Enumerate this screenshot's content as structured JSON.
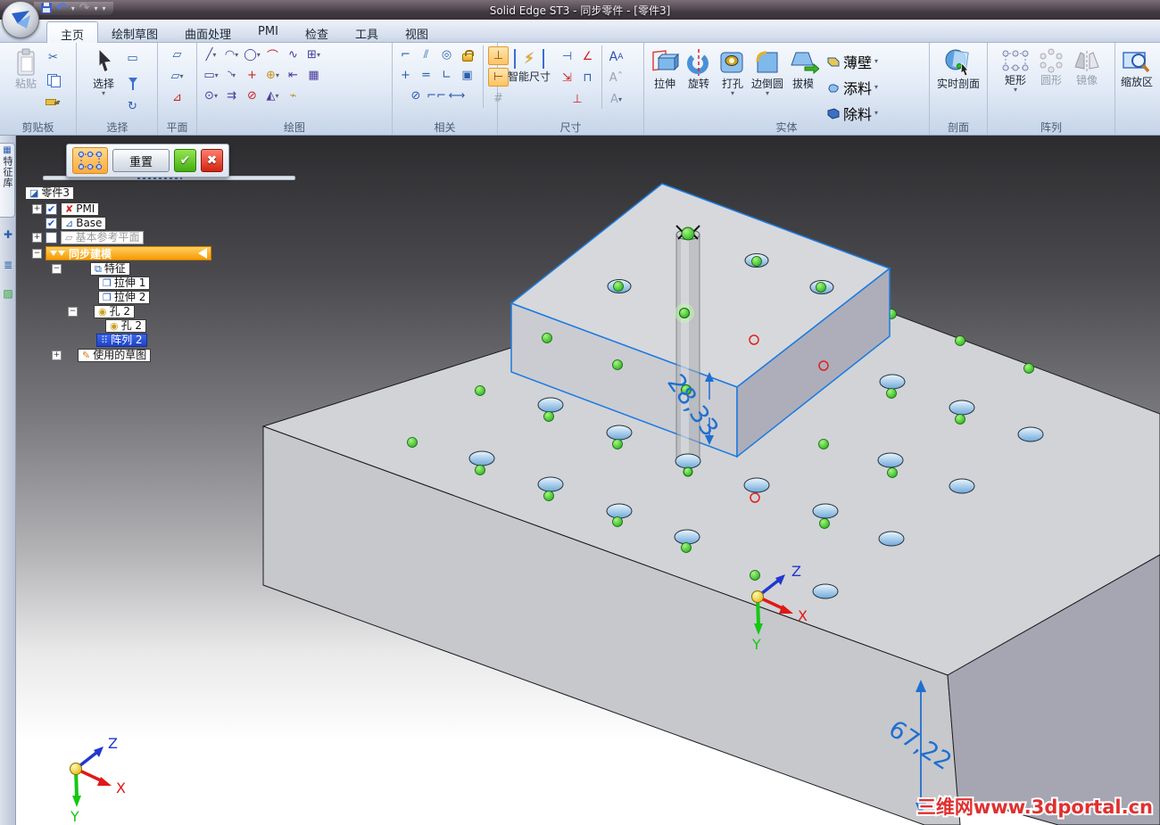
{
  "colors": {
    "selection_blue": "#1b7be0",
    "dimension_blue": "#1f6fd0",
    "handle_green": "#2ecc2e",
    "warning_red": "#e02020",
    "active_tool_orange": "#ffb340",
    "sync_bar_orange": "#f79a00",
    "selected_tree_blue": "#2a52d8"
  },
  "title_bar": {
    "title": "Solid Edge ST3 - 同步零件 - [零件3]"
  },
  "tabs": {
    "items": [
      {
        "label": "主页"
      },
      {
        "label": "绘制草图"
      },
      {
        "label": "曲面处理"
      },
      {
        "label": "PMI"
      },
      {
        "label": "检查"
      },
      {
        "label": "工具"
      },
      {
        "label": "视图"
      }
    ]
  },
  "ribbon": {
    "clipboard": {
      "label": "剪贴板",
      "paste": "粘贴"
    },
    "select": {
      "label": "选择",
      "button": "选择"
    },
    "plane": {
      "label": "平面"
    },
    "draw": {
      "label": "绘图"
    },
    "relate": {
      "label": "相关"
    },
    "dims": {
      "label": "尺寸",
      "smart": "智能尺寸"
    },
    "solids": {
      "label": "实体",
      "extrude": "拉伸",
      "revolve": "旋转",
      "hole": "打孔",
      "round": "边倒圆",
      "draft": "拔模",
      "thin": "薄壁",
      "add": "添料",
      "cut": "除料"
    },
    "section": {
      "label": "剖面",
      "live": "实时剖面"
    },
    "pattern": {
      "label": "阵列",
      "rect": "矩形",
      "circle": "圆形",
      "mirror": "镜像"
    },
    "zoom": {
      "label": "缩放区"
    }
  },
  "command_bar": {
    "reset": "重置"
  },
  "left_strip": {
    "feature_library": "特征库"
  },
  "tree": {
    "items": [
      {
        "label": "零件3"
      },
      {
        "label": "PMI",
        "checked": true
      },
      {
        "label": "Base",
        "checked": true
      },
      {
        "label": "基本参考平面",
        "checked": false
      },
      {
        "label": "同步建模"
      },
      {
        "label": "特征"
      },
      {
        "label": "拉伸 1"
      },
      {
        "label": "拉伸 2"
      },
      {
        "label": "孔 2"
      },
      {
        "label": "孔 2"
      },
      {
        "label": "阵列 2",
        "selected": true
      },
      {
        "label": "使用的草图"
      }
    ]
  },
  "viewport": {
    "dim_block_height": "28,33",
    "dim_base_height": "67,22",
    "axes": {
      "x": "X",
      "y": "Y",
      "z": "Z"
    },
    "watermark": "三维网www.3dportal.cn"
  },
  "icons": {
    "caret": "▾",
    "check": "✔",
    "cross": "✖",
    "plus": "+",
    "minus": "−",
    "scissors": "✂"
  }
}
